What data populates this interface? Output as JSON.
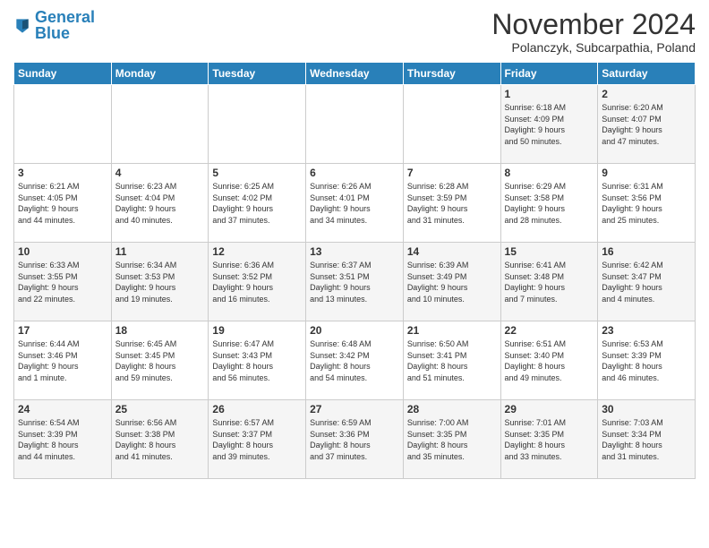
{
  "header": {
    "logo_general": "General",
    "logo_blue": "Blue",
    "month_title": "November 2024",
    "location": "Polanczyk, Subcarpathia, Poland"
  },
  "weekdays": [
    "Sunday",
    "Monday",
    "Tuesday",
    "Wednesday",
    "Thursday",
    "Friday",
    "Saturday"
  ],
  "weeks": [
    [
      {
        "day": "",
        "info": ""
      },
      {
        "day": "",
        "info": ""
      },
      {
        "day": "",
        "info": ""
      },
      {
        "day": "",
        "info": ""
      },
      {
        "day": "",
        "info": ""
      },
      {
        "day": "1",
        "info": "Sunrise: 6:18 AM\nSunset: 4:09 PM\nDaylight: 9 hours\nand 50 minutes."
      },
      {
        "day": "2",
        "info": "Sunrise: 6:20 AM\nSunset: 4:07 PM\nDaylight: 9 hours\nand 47 minutes."
      }
    ],
    [
      {
        "day": "3",
        "info": "Sunrise: 6:21 AM\nSunset: 4:05 PM\nDaylight: 9 hours\nand 44 minutes."
      },
      {
        "day": "4",
        "info": "Sunrise: 6:23 AM\nSunset: 4:04 PM\nDaylight: 9 hours\nand 40 minutes."
      },
      {
        "day": "5",
        "info": "Sunrise: 6:25 AM\nSunset: 4:02 PM\nDaylight: 9 hours\nand 37 minutes."
      },
      {
        "day": "6",
        "info": "Sunrise: 6:26 AM\nSunset: 4:01 PM\nDaylight: 9 hours\nand 34 minutes."
      },
      {
        "day": "7",
        "info": "Sunrise: 6:28 AM\nSunset: 3:59 PM\nDaylight: 9 hours\nand 31 minutes."
      },
      {
        "day": "8",
        "info": "Sunrise: 6:29 AM\nSunset: 3:58 PM\nDaylight: 9 hours\nand 28 minutes."
      },
      {
        "day": "9",
        "info": "Sunrise: 6:31 AM\nSunset: 3:56 PM\nDaylight: 9 hours\nand 25 minutes."
      }
    ],
    [
      {
        "day": "10",
        "info": "Sunrise: 6:33 AM\nSunset: 3:55 PM\nDaylight: 9 hours\nand 22 minutes."
      },
      {
        "day": "11",
        "info": "Sunrise: 6:34 AM\nSunset: 3:53 PM\nDaylight: 9 hours\nand 19 minutes."
      },
      {
        "day": "12",
        "info": "Sunrise: 6:36 AM\nSunset: 3:52 PM\nDaylight: 9 hours\nand 16 minutes."
      },
      {
        "day": "13",
        "info": "Sunrise: 6:37 AM\nSunset: 3:51 PM\nDaylight: 9 hours\nand 13 minutes."
      },
      {
        "day": "14",
        "info": "Sunrise: 6:39 AM\nSunset: 3:49 PM\nDaylight: 9 hours\nand 10 minutes."
      },
      {
        "day": "15",
        "info": "Sunrise: 6:41 AM\nSunset: 3:48 PM\nDaylight: 9 hours\nand 7 minutes."
      },
      {
        "day": "16",
        "info": "Sunrise: 6:42 AM\nSunset: 3:47 PM\nDaylight: 9 hours\nand 4 minutes."
      }
    ],
    [
      {
        "day": "17",
        "info": "Sunrise: 6:44 AM\nSunset: 3:46 PM\nDaylight: 9 hours\nand 1 minute."
      },
      {
        "day": "18",
        "info": "Sunrise: 6:45 AM\nSunset: 3:45 PM\nDaylight: 8 hours\nand 59 minutes."
      },
      {
        "day": "19",
        "info": "Sunrise: 6:47 AM\nSunset: 3:43 PM\nDaylight: 8 hours\nand 56 minutes."
      },
      {
        "day": "20",
        "info": "Sunrise: 6:48 AM\nSunset: 3:42 PM\nDaylight: 8 hours\nand 54 minutes."
      },
      {
        "day": "21",
        "info": "Sunrise: 6:50 AM\nSunset: 3:41 PM\nDaylight: 8 hours\nand 51 minutes."
      },
      {
        "day": "22",
        "info": "Sunrise: 6:51 AM\nSunset: 3:40 PM\nDaylight: 8 hours\nand 49 minutes."
      },
      {
        "day": "23",
        "info": "Sunrise: 6:53 AM\nSunset: 3:39 PM\nDaylight: 8 hours\nand 46 minutes."
      }
    ],
    [
      {
        "day": "24",
        "info": "Sunrise: 6:54 AM\nSunset: 3:39 PM\nDaylight: 8 hours\nand 44 minutes."
      },
      {
        "day": "25",
        "info": "Sunrise: 6:56 AM\nSunset: 3:38 PM\nDaylight: 8 hours\nand 41 minutes."
      },
      {
        "day": "26",
        "info": "Sunrise: 6:57 AM\nSunset: 3:37 PM\nDaylight: 8 hours\nand 39 minutes."
      },
      {
        "day": "27",
        "info": "Sunrise: 6:59 AM\nSunset: 3:36 PM\nDaylight: 8 hours\nand 37 minutes."
      },
      {
        "day": "28",
        "info": "Sunrise: 7:00 AM\nSunset: 3:35 PM\nDaylight: 8 hours\nand 35 minutes."
      },
      {
        "day": "29",
        "info": "Sunrise: 7:01 AM\nSunset: 3:35 PM\nDaylight: 8 hours\nand 33 minutes."
      },
      {
        "day": "30",
        "info": "Sunrise: 7:03 AM\nSunset: 3:34 PM\nDaylight: 8 hours\nand 31 minutes."
      }
    ]
  ]
}
